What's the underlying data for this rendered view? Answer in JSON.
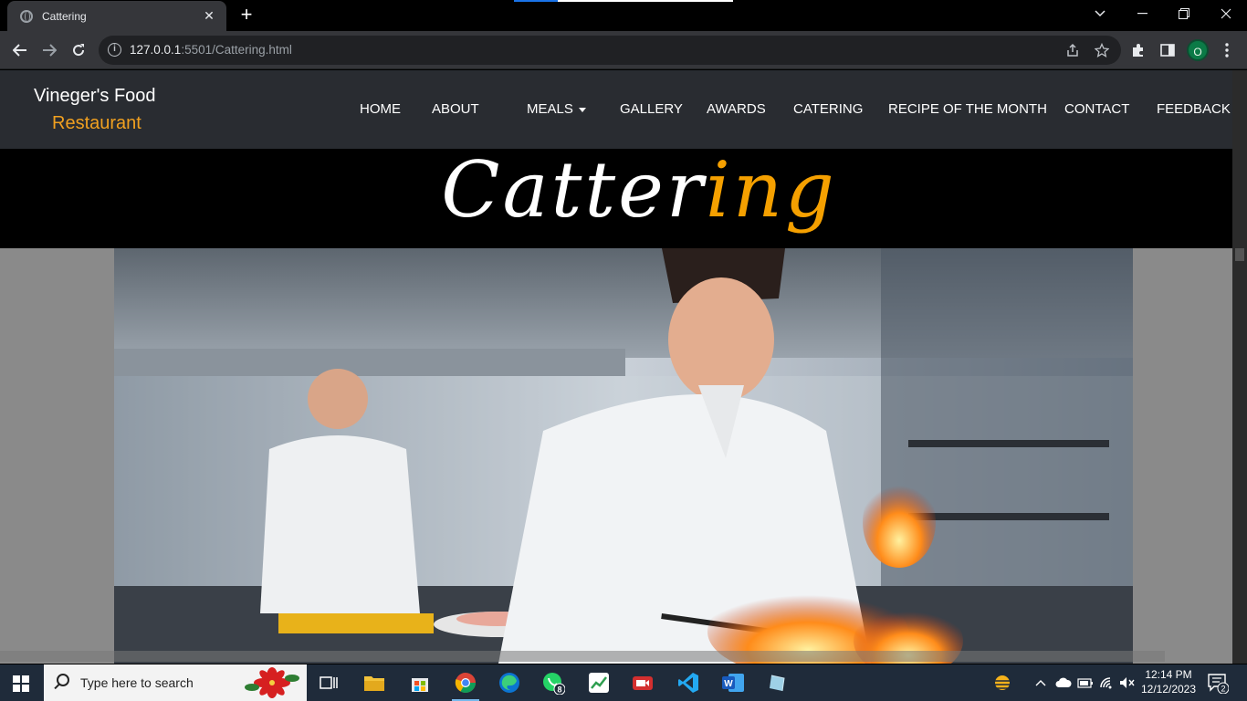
{
  "browser": {
    "tab_title": "Cattering",
    "url_host": "127.0.0.1",
    "url_rest": ":5501/Cattering.html",
    "profile_initial": "O"
  },
  "site": {
    "brand_name": "Vineger's Food",
    "brand_sub": "Restaurant",
    "nav": [
      "HOME",
      "ABOUT",
      "MEALS",
      "GALLERY",
      "AWARDS",
      "CATERING",
      "RECIPE OF THE MONTH",
      "CONTACT",
      "FEEDBACK"
    ],
    "hero_title_main": "Catter",
    "hero_title_accent": "ing",
    "accent_color": "#f5a000"
  },
  "taskbar": {
    "search_placeholder": "Type here to search",
    "whatsapp_badge": "8",
    "time": "12:14 PM",
    "date": "12/12/2023",
    "notification_count": "2"
  }
}
